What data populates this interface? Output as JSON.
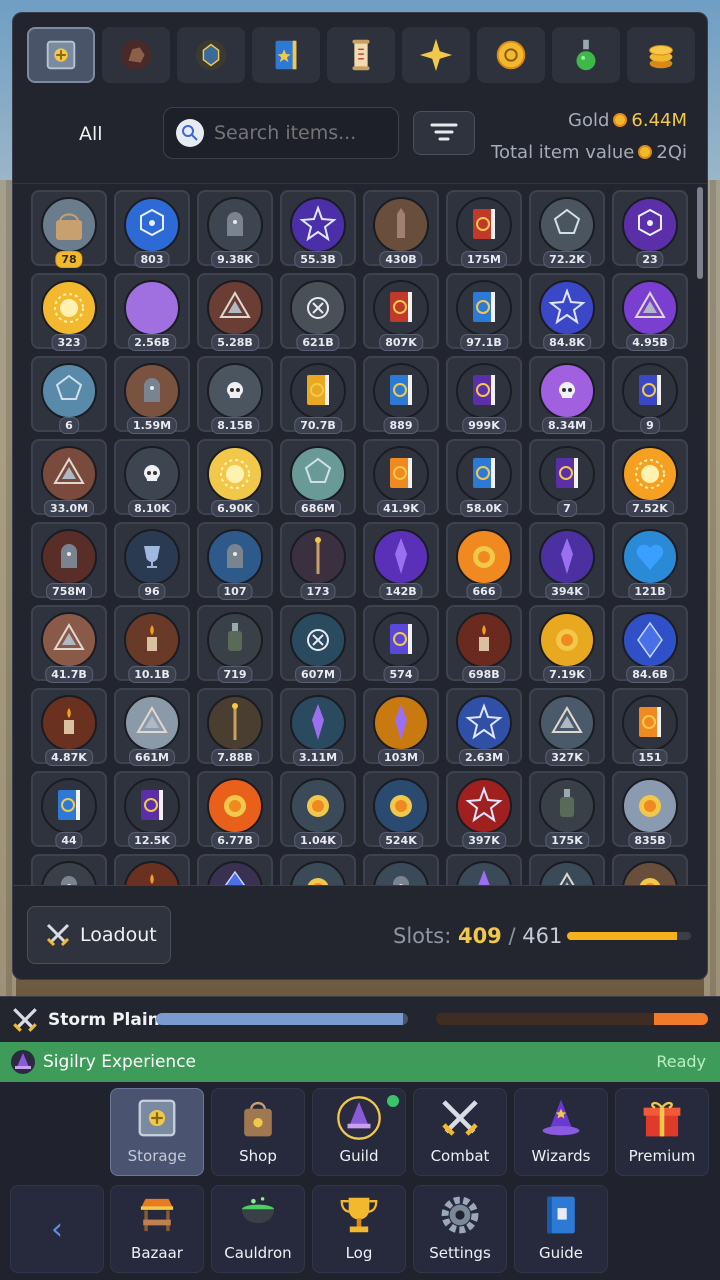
{
  "filters": {
    "all_label": "All",
    "search_placeholder": "Search items...",
    "gold_label": "Gold",
    "gold_value": "6.44M",
    "total_value_label": "Total item value",
    "total_value": "2Qi",
    "categories": [
      {
        "icon": "storage-icon",
        "active": true
      },
      {
        "icon": "ore-icon",
        "active": false
      },
      {
        "icon": "gem-icon",
        "active": false
      },
      {
        "icon": "tome-icon",
        "active": false
      },
      {
        "icon": "scroll-icon",
        "active": false
      },
      {
        "icon": "sparkle-icon",
        "active": false
      },
      {
        "icon": "coin-medal-icon",
        "active": false
      },
      {
        "icon": "potion-icon",
        "active": false
      },
      {
        "icon": "gold-stack-icon",
        "active": false
      }
    ]
  },
  "items": [
    {
      "q": "78",
      "c": "#6b7c8c",
      "s": "bag",
      "gold": true
    },
    {
      "q": "803",
      "c": "#2d6ad6",
      "s": "hex"
    },
    {
      "q": "9.38K",
      "c": "#3d4550",
      "s": "tomb"
    },
    {
      "q": "55.3B",
      "c": "#4a2fa8",
      "s": "star"
    },
    {
      "q": "430B",
      "c": "#6a4e3c",
      "s": "obelisk"
    },
    {
      "q": "175M",
      "c": "#c0392b",
      "s": "book"
    },
    {
      "q": "72.2K",
      "c": "#4a5560",
      "s": "pent"
    },
    {
      "q": "23",
      "c": "#5b2fa8",
      "s": "hex"
    },
    {
      "q": "323",
      "c": "#f2b92e",
      "s": "sun"
    },
    {
      "q": "2.56B",
      "c": "#a070e0",
      "s": "moon"
    },
    {
      "q": "5.28B",
      "c": "#6a3e34",
      "s": "tri"
    },
    {
      "q": "621B",
      "c": "#4a5058",
      "s": "x"
    },
    {
      "q": "807K",
      "c": "#c0392b",
      "s": "book"
    },
    {
      "q": "97.1B",
      "c": "#2d7ad6",
      "s": "book"
    },
    {
      "q": "84.8K",
      "c": "#3a48c8",
      "s": "star"
    },
    {
      "q": "4.95B",
      "c": "#7a3fd0",
      "s": "tri"
    },
    {
      "q": "6",
      "c": "#5a8aaa",
      "s": "pent"
    },
    {
      "q": "1.59M",
      "c": "#7a5240",
      "s": "tomb"
    },
    {
      "q": "8.15B",
      "c": "#4a5560",
      "s": "skull"
    },
    {
      "q": "70.7B",
      "c": "#e8a820",
      "s": "book"
    },
    {
      "q": "889",
      "c": "#2d7ad6",
      "s": "book"
    },
    {
      "q": "999K",
      "c": "#5a2fa8",
      "s": "book"
    },
    {
      "q": "8.34M",
      "c": "#a060e0",
      "s": "skull"
    },
    {
      "q": "9",
      "c": "#3a48c8",
      "s": "book"
    },
    {
      "q": "33.0M",
      "c": "#7a4a3c",
      "s": "tri"
    },
    {
      "q": "8.10K",
      "c": "#3d4550",
      "s": "skull"
    },
    {
      "q": "6.90K",
      "c": "#f2c84b",
      "s": "sun"
    },
    {
      "q": "686M",
      "c": "#6a9a98",
      "s": "pent"
    },
    {
      "q": "41.9K",
      "c": "#f08a20",
      "s": "book"
    },
    {
      "q": "58.0K",
      "c": "#2d7ad6",
      "s": "book"
    },
    {
      "q": "7",
      "c": "#5a2fa8",
      "s": "book"
    },
    {
      "q": "7.52K",
      "c": "#f5a020",
      "s": "sun"
    },
    {
      "q": "758M",
      "c": "#5a2e28",
      "s": "tomb"
    },
    {
      "q": "96",
      "c": "#2a3a50",
      "s": "cup"
    },
    {
      "q": "107",
      "c": "#2d5a8a",
      "s": "tomb"
    },
    {
      "q": "173",
      "c": "#3a3040",
      "s": "wand"
    },
    {
      "q": "142B",
      "c": "#5a30b8",
      "s": "crystal"
    },
    {
      "q": "666",
      "c": "#f08a20",
      "s": "orb"
    },
    {
      "q": "394K",
      "c": "#4a30a0",
      "s": "crystal"
    },
    {
      "q": "121B",
      "c": "#2a8ad6",
      "s": "heart"
    },
    {
      "q": "41.7B",
      "c": "#8a5a48",
      "s": "tri"
    },
    {
      "q": "10.1B",
      "c": "#6a3a28",
      "s": "candle"
    },
    {
      "q": "719",
      "c": "#3a4048",
      "s": "potion"
    },
    {
      "q": "607M",
      "c": "#2a4a60",
      "s": "x"
    },
    {
      "q": "574",
      "c": "#5a48d8",
      "s": "book"
    },
    {
      "q": "698B",
      "c": "#6a2a20",
      "s": "candle"
    },
    {
      "q": "7.19K",
      "c": "#e8a820",
      "s": "orb"
    },
    {
      "q": "84.6B",
      "c": "#3050c8",
      "s": "gem"
    },
    {
      "q": "4.87K",
      "c": "#6a3020",
      "s": "candle"
    },
    {
      "q": "661M",
      "c": "#8a9aa8",
      "s": "tri"
    },
    {
      "q": "7.88B",
      "c": "#4a3e30",
      "s": "wand"
    },
    {
      "q": "3.11M",
      "c": "#2a4a60",
      "s": "crystal"
    },
    {
      "q": "103M",
      "c": "#c87a10",
      "s": "crystal"
    },
    {
      "q": "2.63M",
      "c": "#3050a8",
      "s": "star"
    },
    {
      "q": "327K",
      "c": "#4a5a6a",
      "s": "tri"
    },
    {
      "q": "151",
      "c": "#f08a20",
      "s": "book"
    },
    {
      "q": "44",
      "c": "#2d7ad6",
      "s": "book"
    },
    {
      "q": "12.5K",
      "c": "#5a2fa8",
      "s": "book"
    },
    {
      "q": "6.77B",
      "c": "#e8601a",
      "s": "orb"
    },
    {
      "q": "1.04K",
      "c": "#3a4a58",
      "s": "orb"
    },
    {
      "q": "524K",
      "c": "#2a4a70",
      "s": "orb"
    },
    {
      "q": "397K",
      "c": "#a02020",
      "s": "star"
    },
    {
      "q": "175K",
      "c": "#3a4048",
      "s": "potion"
    },
    {
      "q": "835B",
      "c": "#8a9ab0",
      "s": "orb"
    },
    {
      "q": "",
      "c": "#3a4048",
      "s": "tomb"
    },
    {
      "q": "",
      "c": "#6a3020",
      "s": "candle"
    },
    {
      "q": "",
      "c": "#3a3050",
      "s": "gem"
    },
    {
      "q": "",
      "c": "#3a4a58",
      "s": "orb"
    },
    {
      "q": "",
      "c": "#3a4a58",
      "s": "tomb"
    },
    {
      "q": "",
      "c": "#3a4a58",
      "s": "crystal"
    },
    {
      "q": "",
      "c": "#3a4a58",
      "s": "tri"
    },
    {
      "q": "",
      "c": "#6a4e3c",
      "s": "orb"
    }
  ],
  "inventory": {
    "loadout_label": "Loadout",
    "slots_label": "Slots:",
    "slots_used": "409",
    "slots_sep": "/",
    "slots_total": "461",
    "slots_fill": 0.887
  },
  "area": {
    "name": "Storm Plains",
    "progress": 0.98,
    "enemy_progress": 0.2
  },
  "experience": {
    "name": "Sigilry Experience",
    "status": "Ready"
  },
  "nav": {
    "row1": [
      {
        "label": "Storage",
        "icon": "storage-icon",
        "active": true
      },
      {
        "label": "Shop",
        "icon": "shop-bag-icon",
        "active": false
      },
      {
        "label": "Guild",
        "icon": "guild-wizard-icon",
        "active": false,
        "notify": true
      },
      {
        "label": "Combat",
        "icon": "crossed-swords-icon",
        "active": false
      },
      {
        "label": "Wizards",
        "icon": "wizard-hat-icon",
        "active": false
      },
      {
        "label": "Premium",
        "icon": "gift-icon",
        "active": false
      }
    ],
    "row2": [
      {
        "label": "Bazaar",
        "icon": "market-stall-icon"
      },
      {
        "label": "Cauldron",
        "icon": "cauldron-icon"
      },
      {
        "label": "Log",
        "icon": "trophy-icon"
      },
      {
        "label": "Settings",
        "icon": "gear-icon"
      },
      {
        "label": "Guide",
        "icon": "guide-book-icon"
      }
    ],
    "back_label": "‹"
  }
}
